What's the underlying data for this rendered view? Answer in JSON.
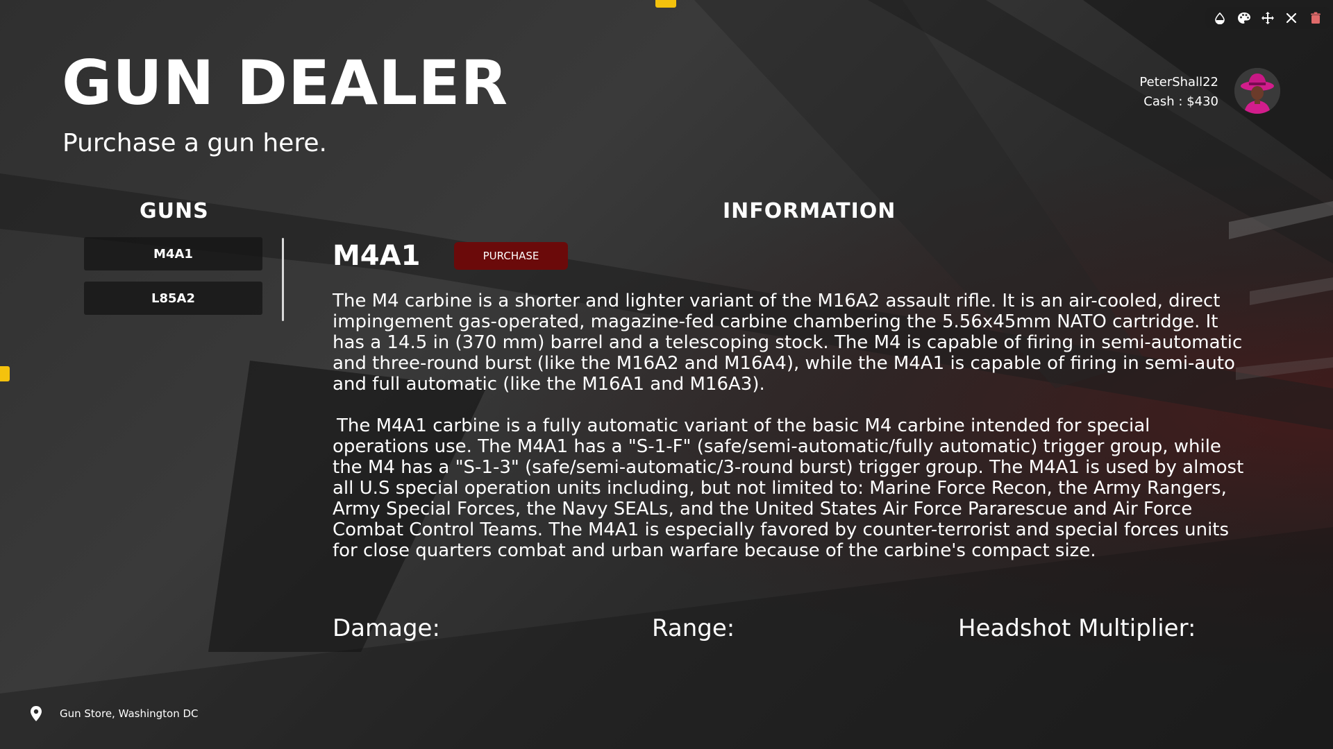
{
  "header": {
    "title": "GUN DEALER",
    "subtitle": "Purchase a gun here."
  },
  "player": {
    "username": "PeterShall22",
    "cash": "Cash : $430"
  },
  "topbar_icons": [
    "drop-icon",
    "palette-icon",
    "move-icon",
    "close-icon",
    "trash-icon"
  ],
  "guns_panel": {
    "heading": "GUNS",
    "items": [
      {
        "label": "M4A1"
      },
      {
        "label": "L85A2"
      }
    ]
  },
  "info_panel": {
    "heading": "INFORMATION",
    "gun_name": "M4A1",
    "purchase_label": "PURCHASE",
    "paragraph1": "The M4 carbine is a shorter and lighter variant of the M16A2 assault rifle. It is an air-cooled, direct impingement gas-operated, magazine-fed carbine chambering the 5.56x45mm NATO cartridge. It has a 14.5 in (370 mm) barrel and a telescoping stock. The M4 is capable of firing in semi-automatic and three-round burst (like the M16A2 and M16A4), while the M4A1 is capable of firing in semi-auto and full automatic (like the M16A1 and M16A3).",
    "paragraph2": "The M4A1 carbine is a fully automatic variant of the basic M4 carbine intended for special operations use. The M4A1 has a \"S-1-F\" (safe/semi-automatic/fully automatic) trigger group, while the M4 has a \"S-1-3\" (safe/semi-automatic/3-round burst) trigger group. The M4A1 is used by almost all U.S special operation units including, but not limited to: Marine Force Recon, the Army Rangers, Army Special Forces, the Navy SEALs, and the United States Air Force Pararescue and Air Force Combat Control Teams. The M4A1 is especially favored by counter-terrorist and special forces units for close quarters combat and urban warfare because of the carbine's compact size.",
    "stats": {
      "damage_label": "Damage:",
      "range_label": "Range:",
      "headshot_label": "Headshot Multiplier:"
    }
  },
  "location": {
    "icon": "location-pin-icon",
    "text": "Gun Store, Washington DC"
  },
  "colors": {
    "purchase_button": "#6b0a0a",
    "accent_yellow": "#f4c20d",
    "text": "#ffffff"
  }
}
